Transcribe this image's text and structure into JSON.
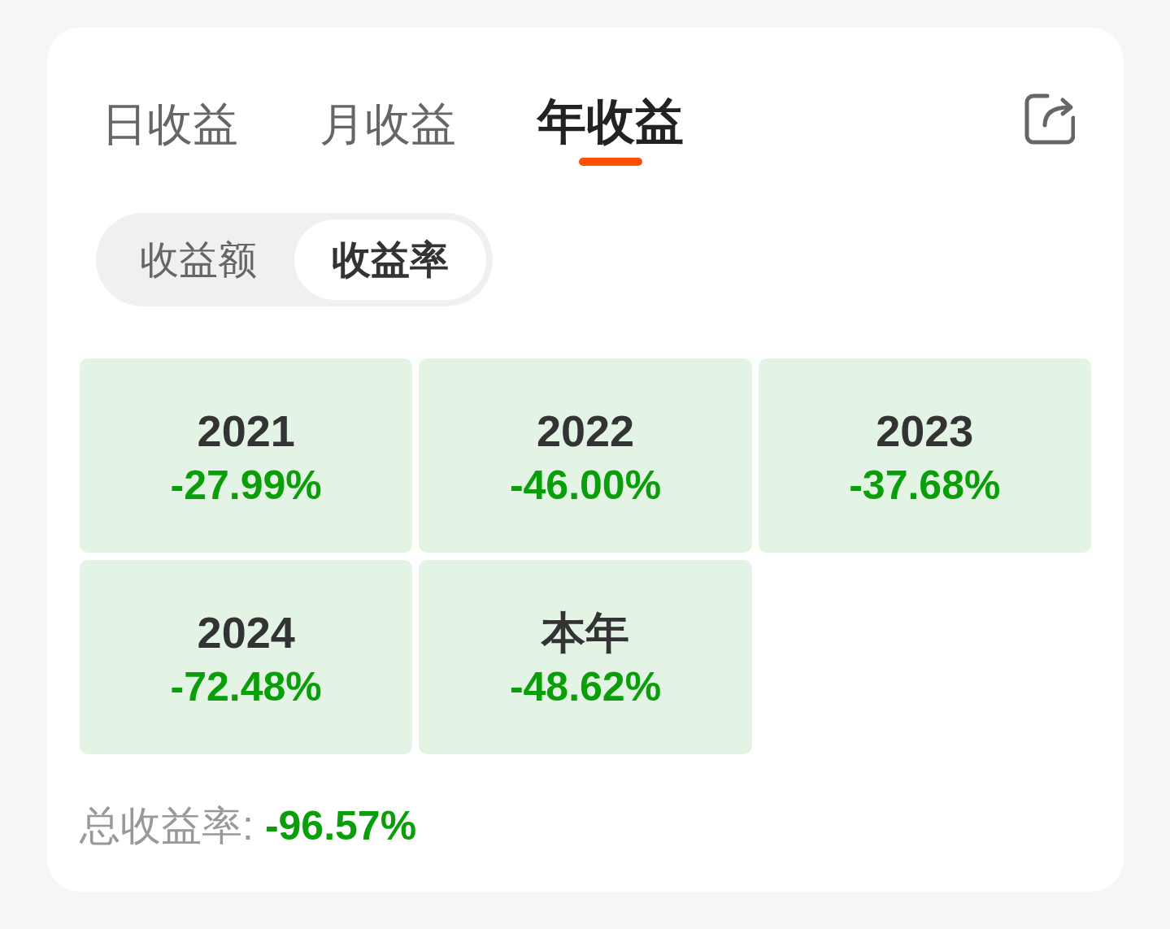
{
  "tabs": [
    {
      "label": "日收益",
      "selected": false
    },
    {
      "label": "月收益",
      "selected": false
    },
    {
      "label": "年收益",
      "selected": true
    }
  ],
  "segment": [
    {
      "label": "收益额",
      "selected": false
    },
    {
      "label": "收益率",
      "selected": true
    }
  ],
  "tiles": [
    {
      "label": "2021",
      "value": "-27.99%"
    },
    {
      "label": "2022",
      "value": "-46.00%"
    },
    {
      "label": "2023",
      "value": "-37.68%"
    },
    {
      "label": "2024",
      "value": "-72.48%"
    },
    {
      "label": "本年",
      "value": "-48.62%"
    }
  ],
  "total": {
    "label": "总收益率:",
    "value": "-96.57%"
  }
}
